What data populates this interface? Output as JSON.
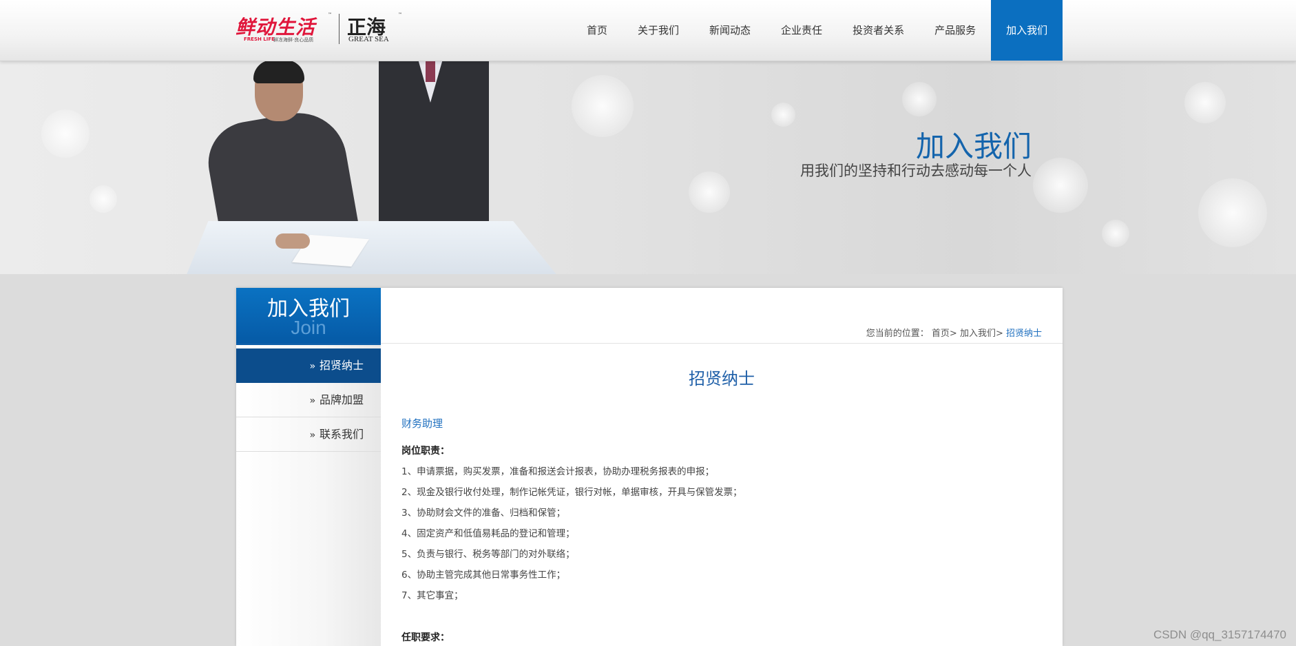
{
  "header": {
    "logo": {
      "brand_cn": "鲜动生活",
      "brand_en": "FRESH LIFE",
      "brand_tagline": "鲜冻海鲜·良心品质",
      "partner_cn": "正海",
      "partner_en": "GREAT SEA",
      "tm": "™"
    },
    "nav": [
      {
        "label": "首页",
        "active": false
      },
      {
        "label": "关于我们",
        "active": false
      },
      {
        "label": "新闻动态",
        "active": false
      },
      {
        "label": "企业责任",
        "active": false
      },
      {
        "label": "投资者关系",
        "active": false
      },
      {
        "label": "产品服务",
        "active": false
      },
      {
        "label": "加入我们",
        "active": true
      }
    ]
  },
  "banner": {
    "title": "加入我们",
    "subtitle": "用我们的坚持和行动去感动每一个人"
  },
  "sidebar": {
    "title": "加入我们",
    "title_en": "Join",
    "chevron": "»",
    "items": [
      {
        "label": "招贤纳士",
        "active": true
      },
      {
        "label": "品牌加盟",
        "active": false
      },
      {
        "label": "联系我们",
        "active": false
      }
    ]
  },
  "breadcrumb": {
    "prefix": "您当前的位置：",
    "home": "首页>",
    "section": "加入我们>",
    "current": "招贤纳士"
  },
  "content": {
    "title": "招贤纳士",
    "job_title": "财务助理",
    "duties_heading": "岗位职责：",
    "duties": [
      "1、申请票据，购买发票，准备和报送会计报表，协助办理税务报表的申报；",
      "2、现金及银行收付处理，制作记帐凭证，银行对帐，单据审核，开具与保管发票；",
      "3、协助财会文件的准备、归档和保管；",
      "4、固定资产和低值易耗品的登记和管理；",
      "5、负责与银行、税务等部门的对外联络；",
      "6、协助主管完成其他日常事务性工作；",
      "7、其它事宜；"
    ],
    "requirements_heading": "任职要求："
  },
  "watermark": "CSDN @qq_3157174470",
  "colors": {
    "accent": "#0b6fc0",
    "sidebar_active": "#0c4d8c",
    "title_blue": "#1e5fa8",
    "link_blue": "#1e6fbf"
  }
}
